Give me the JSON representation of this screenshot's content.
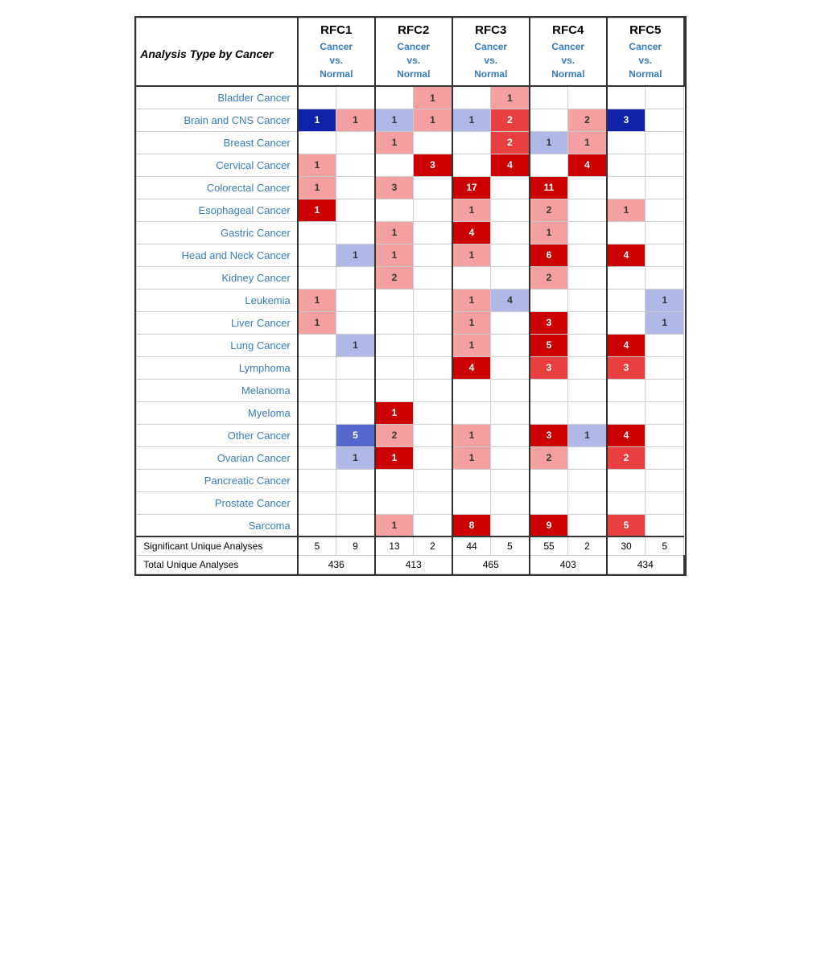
{
  "rfcs": [
    "RFC1",
    "RFC2",
    "RFC3",
    "RFC4",
    "RFC5"
  ],
  "subheader": "Cancer\nvs.\nNormal",
  "analysis_label": "Analysis Type by Cancer",
  "cancers": [
    "Bladder Cancer",
    "Brain and CNS Cancer",
    "Breast Cancer",
    "Cervical Cancer",
    "Colorectal Cancer",
    "Esophageal Cancer",
    "Gastric Cancer",
    "Head and Neck Cancer",
    "Kidney Cancer",
    "Leukemia",
    "Liver Cancer",
    "Lung Cancer",
    "Lymphoma",
    "Melanoma",
    "Myeloma",
    "Other Cancer",
    "Ovarian Cancer",
    "Pancreatic Cancer",
    "Prostate Cancer",
    "Sarcoma"
  ],
  "cells": {
    "Bladder Cancer": [
      [
        "",
        ""
      ],
      [
        "",
        ""
      ],
      [
        "",
        ""
      ],
      [
        "1",
        "red-light"
      ],
      [
        "",
        ""
      ],
      [
        "1",
        "red-light"
      ],
      [
        "",
        ""
      ]
    ],
    "Brain and CNS Cancer": [
      [
        "1",
        "blue-dark"
      ],
      [
        "1",
        "red-light"
      ],
      [
        "1",
        "blue-light"
      ],
      [
        "1",
        "red-light"
      ],
      [
        "1",
        "blue-light"
      ],
      [
        "2",
        "red-medium"
      ],
      [
        "",
        ""
      ],
      [
        "2",
        "red-light"
      ],
      [
        "3",
        "blue-dark"
      ]
    ],
    "Breast Cancer": [
      [
        "",
        ""
      ],
      [
        "",
        ""
      ],
      [
        "1",
        "red-light"
      ],
      [
        "",
        ""
      ],
      [
        "",
        ""
      ],
      [
        "2",
        "red-medium"
      ],
      [
        "1",
        "blue-light"
      ],
      [
        "1",
        "red-light"
      ],
      [
        "",
        ""
      ]
    ],
    "Cervical Cancer": [
      [
        "1",
        "red-light"
      ],
      [
        "",
        ""
      ],
      [
        "",
        ""
      ],
      [
        "3",
        "red-dark"
      ],
      [
        "",
        ""
      ],
      [
        "4",
        "red-dark"
      ],
      [
        "",
        ""
      ],
      [
        "4",
        "red-dark"
      ],
      [
        "",
        ""
      ]
    ],
    "Colorectal Cancer": [
      [
        "1",
        "red-light"
      ],
      [
        "",
        ""
      ],
      [
        "3",
        "red-light"
      ],
      [
        "",
        ""
      ],
      [
        "17",
        "red-dark"
      ],
      [
        "",
        ""
      ],
      [
        "11",
        "red-dark"
      ],
      [
        "",
        ""
      ],
      [
        "",
        ""
      ]
    ],
    "Esophageal Cancer": [
      [
        "1",
        "red-dark"
      ],
      [
        "",
        ""
      ],
      [
        "",
        ""
      ],
      [
        "",
        ""
      ],
      [
        "1",
        "red-light"
      ],
      [
        "",
        ""
      ],
      [
        "2",
        "red-light"
      ],
      [
        "",
        ""
      ],
      [
        "1",
        "red-light"
      ],
      [
        "",
        ""
      ]
    ],
    "Gastric Cancer": [
      [
        "",
        ""
      ],
      [
        "",
        ""
      ],
      [
        "1",
        "red-light"
      ],
      [
        "",
        ""
      ],
      [
        "4",
        "red-dark"
      ],
      [
        "",
        ""
      ],
      [
        "1",
        "red-light"
      ],
      [
        "",
        ""
      ],
      [
        "",
        ""
      ]
    ],
    "Head and Neck Cancer": [
      [
        "",
        ""
      ],
      [
        "1",
        "blue-light"
      ],
      [
        "1",
        "red-light"
      ],
      [
        "",
        ""
      ],
      [
        "1",
        "red-light"
      ],
      [
        "",
        ""
      ],
      [
        "6",
        "red-dark"
      ],
      [
        "",
        ""
      ],
      [
        "4",
        "red-dark"
      ],
      [
        "",
        ""
      ]
    ],
    "Kidney Cancer": [
      [
        "",
        ""
      ],
      [
        "",
        ""
      ],
      [
        "2",
        "red-light"
      ],
      [
        "",
        ""
      ],
      [
        "",
        ""
      ],
      [
        "",
        ""
      ],
      [
        "2",
        "red-light"
      ],
      [
        "",
        ""
      ],
      [
        "",
        ""
      ]
    ],
    "Leukemia": [
      [
        "1",
        "red-light"
      ],
      [
        "",
        ""
      ],
      [
        "",
        ""
      ],
      [
        "",
        ""
      ],
      [
        "1",
        "red-light"
      ],
      [
        "4",
        "blue-light"
      ],
      [
        "",
        ""
      ],
      [
        "",
        ""
      ],
      [
        "",
        ""
      ],
      [
        "1",
        "blue-light"
      ]
    ],
    "Liver Cancer": [
      [
        "1",
        "red-light"
      ],
      [
        "",
        ""
      ],
      [
        "",
        ""
      ],
      [
        "",
        ""
      ],
      [
        "1",
        "red-light"
      ],
      [
        "",
        ""
      ],
      [
        "3",
        "red-dark"
      ],
      [
        "",
        ""
      ],
      [
        "",
        ""
      ],
      [
        "1",
        "blue-light"
      ]
    ],
    "Lung Cancer": [
      [
        "",
        ""
      ],
      [
        "1",
        "blue-light"
      ],
      [
        "",
        ""
      ],
      [
        "",
        ""
      ],
      [
        "1",
        "red-light"
      ],
      [
        "",
        ""
      ],
      [
        "5",
        "red-dark"
      ],
      [
        "",
        ""
      ],
      [
        "4",
        "red-dark"
      ],
      [
        "",
        ""
      ]
    ],
    "Lymphoma": [
      [
        "",
        ""
      ],
      [
        "",
        ""
      ],
      [
        "",
        ""
      ],
      [
        "",
        ""
      ],
      [
        "4",
        "red-dark"
      ],
      [
        "",
        ""
      ],
      [
        "3",
        "red-medium"
      ],
      [
        "",
        ""
      ],
      [
        "3",
        "red-medium"
      ],
      [
        "",
        ""
      ]
    ],
    "Melanoma": [
      [
        "",
        ""
      ],
      [
        "",
        ""
      ],
      [
        "",
        ""
      ],
      [
        "",
        ""
      ],
      [
        "",
        ""
      ],
      [
        "",
        ""
      ],
      [
        "",
        ""
      ],
      [
        "",
        ""
      ],
      [
        "",
        ""
      ]
    ],
    "Myeloma": [
      [
        "",
        ""
      ],
      [
        "",
        ""
      ],
      [
        "1",
        "red-dark"
      ],
      [
        "",
        ""
      ],
      [
        "",
        ""
      ],
      [
        "",
        ""
      ],
      [
        "",
        ""
      ],
      [
        "",
        ""
      ],
      [
        "",
        ""
      ]
    ],
    "Other Cancer": [
      [
        "",
        ""
      ],
      [
        "5",
        "blue-medium"
      ],
      [
        "2",
        "red-light"
      ],
      [
        "",
        ""
      ],
      [
        "1",
        "red-light"
      ],
      [
        "",
        ""
      ],
      [
        "3",
        "red-dark"
      ],
      [
        "1",
        "blue-light"
      ],
      [
        "4",
        "red-dark"
      ],
      [
        "",
        ""
      ]
    ],
    "Ovarian Cancer": [
      [
        "",
        ""
      ],
      [
        "1",
        "blue-light"
      ],
      [
        "1",
        "red-dark"
      ],
      [
        "",
        ""
      ],
      [
        "1",
        "red-light"
      ],
      [
        "",
        ""
      ],
      [
        "2",
        "red-light"
      ],
      [
        "",
        ""
      ],
      [
        "2",
        "red-medium"
      ],
      [
        "",
        ""
      ]
    ],
    "Pancreatic Cancer": [
      [
        "",
        ""
      ],
      [
        "",
        ""
      ],
      [
        "",
        ""
      ],
      [
        "",
        ""
      ],
      [
        "",
        ""
      ],
      [
        "",
        ""
      ],
      [
        "",
        ""
      ],
      [
        "",
        ""
      ],
      [
        "",
        ""
      ]
    ],
    "Prostate Cancer": [
      [
        "",
        ""
      ],
      [
        "",
        ""
      ],
      [
        "",
        ""
      ],
      [
        "",
        ""
      ],
      [
        "",
        ""
      ],
      [
        "",
        ""
      ],
      [
        "",
        ""
      ],
      [
        "",
        ""
      ],
      [
        "",
        ""
      ]
    ],
    "Sarcoma": [
      [
        "",
        ""
      ],
      [
        "",
        ""
      ],
      [
        "1",
        "red-light"
      ],
      [
        "",
        ""
      ],
      [
        "8",
        "red-dark"
      ],
      [
        "",
        ""
      ],
      [
        "9",
        "red-dark"
      ],
      [
        "",
        ""
      ],
      [
        "5",
        "red-medium"
      ],
      [
        "",
        ""
      ]
    ]
  },
  "footer": {
    "sig_label": "Significant Unique Analyses",
    "total_label": "Total Unique Analyses",
    "sig_values": [
      "5",
      "9",
      "13",
      "2",
      "44",
      "5",
      "55",
      "2",
      "30",
      "5"
    ],
    "total_values": [
      "436",
      "413",
      "465",
      "403",
      "434"
    ]
  }
}
